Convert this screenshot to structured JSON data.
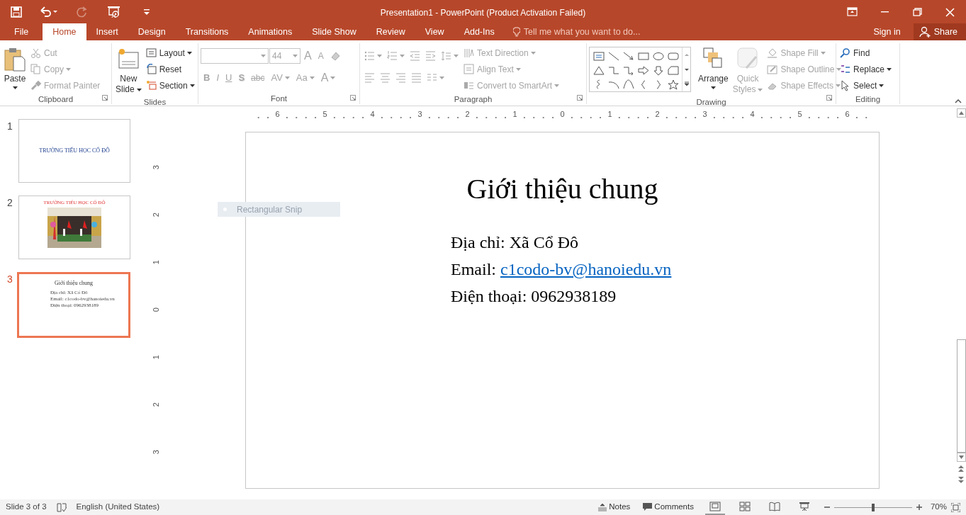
{
  "window": {
    "title": "Presentation1 - PowerPoint (Product Activation Failed)"
  },
  "quick_access": [
    {
      "kind": "save",
      "disabled": false
    },
    {
      "kind": "undo",
      "disabled": false
    },
    {
      "kind": "redo",
      "disabled": true
    },
    {
      "kind": "present",
      "disabled": false
    },
    {
      "kind": "customize",
      "disabled": false
    }
  ],
  "tabs": [
    {
      "label": "File",
      "selected": false
    },
    {
      "label": "Home",
      "selected": true
    },
    {
      "label": "Insert",
      "selected": false
    },
    {
      "label": "Design",
      "selected": false
    },
    {
      "label": "Transitions",
      "selected": false
    },
    {
      "label": "Animations",
      "selected": false
    },
    {
      "label": "Slide Show",
      "selected": false
    },
    {
      "label": "Review",
      "selected": false
    },
    {
      "label": "View",
      "selected": false
    },
    {
      "label": "Add-Ins",
      "selected": false
    }
  ],
  "tell_me": {
    "placeholder": "Tell me what you want to do..."
  },
  "account": {
    "sign_in": "Sign in",
    "share": "Share"
  },
  "ribbon": [
    {
      "label": "Clipboard",
      "launcher": true,
      "columns": [
        [
          {
            "kind": "large",
            "label": "Paste",
            "disabled": false,
            "dropdown": true
          }
        ],
        [
          {
            "kind": "small",
            "label": "Cut",
            "disabled": true,
            "dropdown": false
          },
          {
            "kind": "small",
            "label": "Copy",
            "disabled": true,
            "dropdown": true
          },
          {
            "kind": "small",
            "label": "Format Painter",
            "disabled": true,
            "dropdown": false
          }
        ]
      ]
    },
    {
      "label": "Slides",
      "launcher": false,
      "columns": [
        [
          {
            "kind": "large",
            "label": "New",
            "label2": "Slide",
            "disabled": false,
            "dropdown": true
          }
        ],
        [
          {
            "kind": "small",
            "label": "Layout",
            "disabled": false,
            "dropdown": true
          },
          {
            "kind": "small",
            "label": "Reset",
            "disabled": false,
            "dropdown": false
          },
          {
            "kind": "small",
            "label": "Section",
            "disabled": false,
            "dropdown": true
          }
        ]
      ]
    },
    {
      "label": "Font",
      "launcher": true,
      "columns": [
        [
          {
            "kind": "row",
            "items": [
              {
                "kind": "field",
                "value": "",
                "disabled": true
              },
              {
                "kind": "field",
                "value": "44",
                "disabled": true
              },
              {
                "kind": "letter",
                "label": "A",
                "disabled": true,
                "dropdown": false
              },
              {
                "kind": "letter",
                "label": "A",
                "disabled": true,
                "dropdown": false
              },
              {
                "kind": "icon",
                "disabled": true,
                "dropdown": false
              }
            ]
          },
          {
            "kind": "row",
            "items": [
              {
                "kind": "letter",
                "label": "B",
                "disabled": true,
                "dropdown": false
              },
              {
                "kind": "letter",
                "label": "I",
                "disabled": true,
                "dropdown": false
              },
              {
                "kind": "letter",
                "label": "U",
                "disabled": true,
                "dropdown": false
              },
              {
                "kind": "letter",
                "label": "S",
                "disabled": true,
                "dropdown": false
              },
              {
                "kind": "letter",
                "label": "abc",
                "disabled": true,
                "dropdown": false
              },
              {
                "kind": "letter",
                "label": "AV",
                "disabled": true,
                "dropdown": true
              },
              {
                "kind": "letter",
                "label": "Aa",
                "disabled": true,
                "dropdown": true
              },
              {
                "kind": "letter",
                "label": "A",
                "disabled": true,
                "dropdown": true
              }
            ]
          }
        ]
      ]
    },
    {
      "label": "Paragraph",
      "launcher": true,
      "columns": [
        [
          {
            "kind": "row",
            "items": [
              {
                "kind": "icon",
                "disabled": true,
                "dropdown": true
              },
              {
                "kind": "icon",
                "disabled": true,
                "dropdown": true
              },
              {
                "kind": "icon",
                "disabled": true,
                "dropdown": false
              },
              {
                "kind": "icon",
                "disabled": true,
                "dropdown": false
              },
              {
                "kind": "icon",
                "disabled": true,
                "dropdown": true
              }
            ]
          },
          {
            "kind": "row",
            "items": [
              {
                "kind": "icon",
                "disabled": true,
                "dropdown": false
              },
              {
                "kind": "icon",
                "disabled": true,
                "dropdown": false
              },
              {
                "kind": "icon",
                "disabled": true,
                "dropdown": false
              },
              {
                "kind": "icon",
                "disabled": true,
                "dropdown": false
              },
              {
                "kind": "icon",
                "disabled": true,
                "dropdown": true
              }
            ]
          }
        ],
        [
          {
            "kind": "small",
            "label": "Text Direction",
            "disabled": true,
            "dropdown": true
          },
          {
            "kind": "small",
            "label": "Align Text",
            "disabled": true,
            "dropdown": true
          },
          {
            "kind": "small",
            "label": "Convert to SmartArt",
            "disabled": true,
            "dropdown": true
          }
        ]
      ]
    },
    {
      "label": "Drawing",
      "launcher": true,
      "columns": [
        [
          {
            "kind": "gallery"
          }
        ],
        [
          {
            "kind": "large",
            "label": "Arrange",
            "disabled": false,
            "dropdown": true
          }
        ],
        [
          {
            "kind": "large",
            "label": "Quick",
            "label2": "Styles",
            "disabled": true,
            "dropdown": true
          }
        ],
        [
          {
            "kind": "small",
            "label": "Shape Fill",
            "disabled": true,
            "dropdown": true
          },
          {
            "kind": "small",
            "label": "Shape Outline",
            "disabled": true,
            "dropdown": true
          },
          {
            "kind": "small",
            "label": "Shape Effects",
            "disabled": true,
            "dropdown": true
          }
        ]
      ]
    },
    {
      "label": "Editing",
      "launcher": false,
      "columns": [
        [
          {
            "kind": "small",
            "label": "Find",
            "disabled": false,
            "dropdown": false
          },
          {
            "kind": "small",
            "label": "Replace",
            "disabled": false,
            "dropdown": true
          },
          {
            "kind": "small",
            "label": "Select",
            "disabled": false,
            "dropdown": true
          }
        ]
      ]
    }
  ],
  "ruler": {
    "horizontal": [
      "6",
      "5",
      "4",
      "3",
      "2",
      "1",
      "0",
      "1",
      "2",
      "3",
      "4",
      "5",
      "6"
    ],
    "vertical": [
      "3",
      "2",
      "1",
      "0",
      "1",
      "2",
      "3"
    ]
  },
  "thumbnails": [
    {
      "number": "1",
      "selected": false,
      "kind": "title",
      "title": "TRƯỜNG TIỂU HỌC CỔ ĐÔ"
    },
    {
      "number": "2",
      "selected": false,
      "kind": "picture",
      "title": "TRƯỜNG TIỂU HỌC CỔ ĐÔ"
    },
    {
      "number": "3",
      "selected": true,
      "kind": "content",
      "title": "Giới thiệu chung",
      "lines": [
        "Địa chỉ: Xã Cổ Đô",
        "Email: c1codo-bv@hanoiedu.vn",
        "Điện thoại: 0962938189"
      ]
    }
  ],
  "slide": {
    "title": "Giới thiệu chung",
    "lines": [
      {
        "label": "Địa chỉ: Xã Cổ Đô"
      },
      {
        "label": "Email: ",
        "link": "c1codo-bv@hanoiedu.vn"
      },
      {
        "label": "Điện thoại: 0962938189"
      }
    ]
  },
  "snip_tooltip": {
    "label": "Rectangular Snip"
  },
  "status_bar": {
    "slide": "Slide 3 of 3",
    "language": "English (United States)",
    "notes": "Notes",
    "comments": "Comments",
    "views": [
      {
        "selected": true
      },
      {
        "selected": false
      },
      {
        "selected": false
      },
      {
        "selected": false
      }
    ],
    "zoom": {
      "level": 0.5,
      "reading": "70%"
    }
  }
}
